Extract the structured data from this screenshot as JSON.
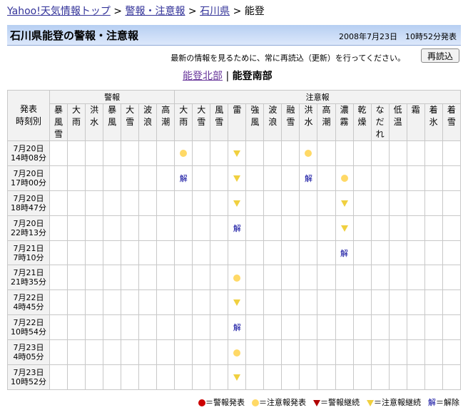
{
  "breadcrumb": {
    "items": [
      "Yahoo!天気情報トップ",
      "警報・注意報",
      "石川県"
    ],
    "separator": ">",
    "current": "能登"
  },
  "header": {
    "title": "石川県能登の警報・注意報",
    "datetime": "2008年7月23日　10時52分発表"
  },
  "notice": "最新の情報を見るために、常に再読込（更新）を行ってください。",
  "reload_label": "再読込",
  "areas": {
    "link": "能登北部",
    "separator": "|",
    "current": "能登南部"
  },
  "table": {
    "corner": [
      "発表",
      "時刻別"
    ],
    "groups": [
      {
        "label": "警報",
        "span": 7
      },
      {
        "label": "注意報",
        "span": 16
      }
    ],
    "columns": [
      [
        "暴",
        "風",
        "雪"
      ],
      [
        "大",
        "雨"
      ],
      [
        "洪",
        "水"
      ],
      [
        "暴",
        "風"
      ],
      [
        "大",
        "雪"
      ],
      [
        "波",
        "浪"
      ],
      [
        "高",
        "潮"
      ],
      [
        "大",
        "雨"
      ],
      [
        "大",
        "雪"
      ],
      [
        "風",
        "雪"
      ],
      [
        "雷"
      ],
      [
        "強",
        "風"
      ],
      [
        "波",
        "浪"
      ],
      [
        "融",
        "雪"
      ],
      [
        "洪",
        "水"
      ],
      [
        "高",
        "潮"
      ],
      [
        "濃",
        "霧"
      ],
      [
        "乾",
        "燥"
      ],
      [
        "な",
        "だ",
        "れ"
      ],
      [
        "低",
        "温"
      ],
      [
        "霜"
      ],
      [
        "着",
        "氷"
      ],
      [
        "着",
        "雪"
      ]
    ],
    "rows": [
      {
        "date": "7月20日",
        "time": "14時08分",
        "cells": {
          "7": "dot",
          "10": "tri",
          "14": "dot"
        }
      },
      {
        "date": "7月20日",
        "time": "17時00分",
        "cells": {
          "7": "kai",
          "10": "tri",
          "14": "kai",
          "16": "dot"
        }
      },
      {
        "date": "7月20日",
        "time": "18時47分",
        "cells": {
          "10": "tri",
          "16": "tri"
        }
      },
      {
        "date": "7月20日",
        "time": "22時13分",
        "cells": {
          "10": "kai",
          "16": "tri"
        }
      },
      {
        "date": "7月21日",
        "time": "7時10分",
        "cells": {
          "16": "kai"
        }
      },
      {
        "date": "7月21日",
        "time": "21時35分",
        "cells": {
          "10": "dot"
        }
      },
      {
        "date": "7月22日",
        "time": "4時45分",
        "cells": {
          "10": "tri"
        }
      },
      {
        "date": "7月22日",
        "time": "10時54分",
        "cells": {
          "10": "kai"
        }
      },
      {
        "date": "7月23日",
        "time": "4時05分",
        "cells": {
          "10": "dot"
        }
      },
      {
        "date": "7月23日",
        "time": "10時52分",
        "cells": {
          "10": "tri"
        }
      }
    ],
    "kai_label": "解"
  },
  "legend": [
    {
      "icon": "red-dot",
      "label": "＝警報発表"
    },
    {
      "icon": "yellow-dot",
      "label": "＝注意報発表"
    },
    {
      "icon": "red-triangle",
      "label": "＝警報継続"
    },
    {
      "icon": "yellow-triangle",
      "label": "＝注意報継続"
    },
    {
      "icon": "kai",
      "label": "＝解除"
    }
  ]
}
